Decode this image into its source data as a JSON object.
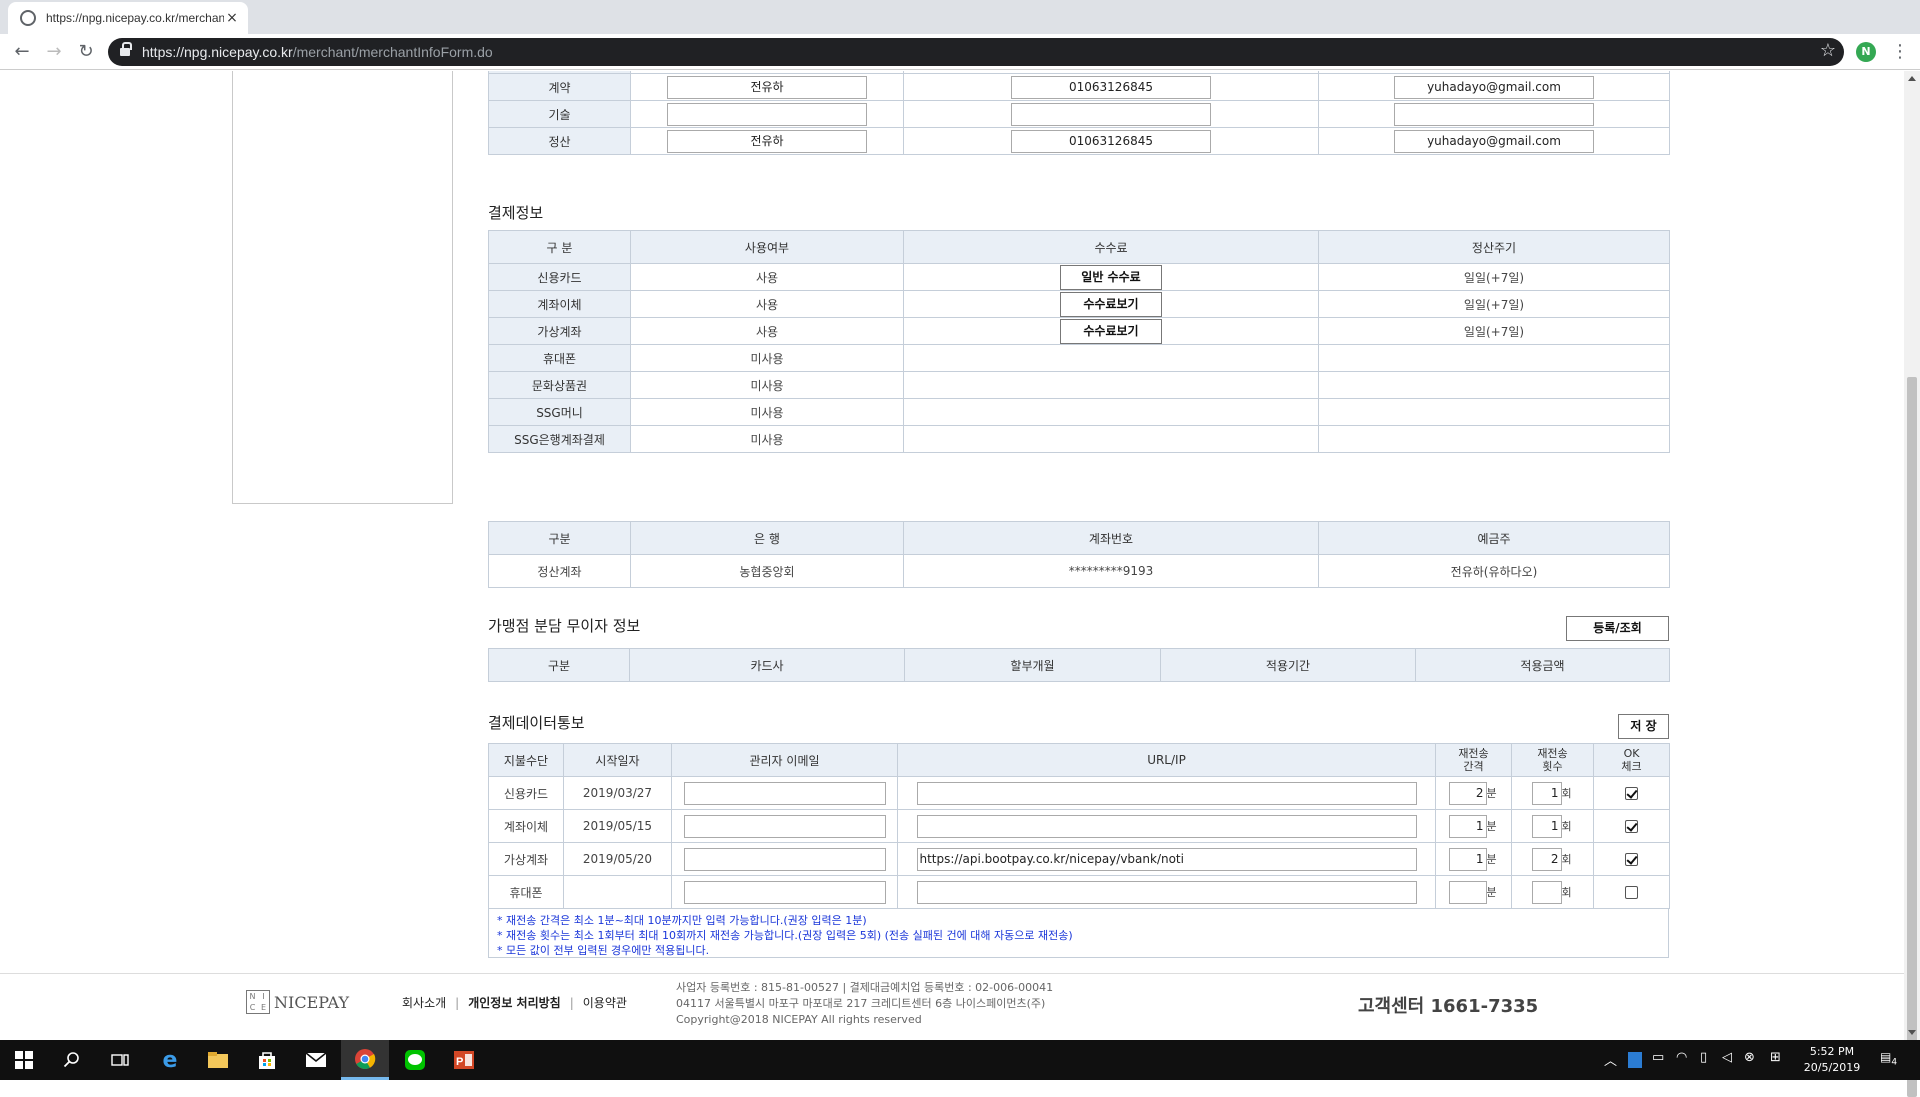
{
  "browser": {
    "tab_title": "https://npg.nicepay.co.kr/merchant",
    "tab_close": "×",
    "url_host": "https://npg.nicepay.co.kr",
    "url_path": "/merchant/merchantInfoForm.do",
    "profile_initial": "N"
  },
  "contacts": {
    "rows": [
      {
        "label": "계약",
        "name": "전유하",
        "phone": "01063126845",
        "email": "yuhadayo@gmail.com"
      },
      {
        "label": "기술",
        "name": "",
        "phone": "",
        "email": ""
      },
      {
        "label": "정산",
        "name": "전유하",
        "phone": "01063126845",
        "email": "yuhadayo@gmail.com"
      }
    ]
  },
  "payment_info": {
    "title": "결제정보",
    "headers": [
      "구 분",
      "사용여부",
      "수수료",
      "정산주기"
    ],
    "rows": [
      {
        "method": "신용카드",
        "usage": "사용",
        "fee_button": "일반 수수료",
        "cycle": "일일(+7일)"
      },
      {
        "method": "계좌이체",
        "usage": "사용",
        "fee_button": "수수료보기",
        "cycle": "일일(+7일)"
      },
      {
        "method": "가상계좌",
        "usage": "사용",
        "fee_button": "수수료보기",
        "cycle": "일일(+7일)"
      },
      {
        "method": "휴대폰",
        "usage": "미사용",
        "fee_button": "",
        "cycle": ""
      },
      {
        "method": "문화상품권",
        "usage": "미사용",
        "fee_button": "",
        "cycle": ""
      },
      {
        "method": "SSG머니",
        "usage": "미사용",
        "fee_button": "",
        "cycle": ""
      },
      {
        "method": "SSG은행계좌결제",
        "usage": "미사용",
        "fee_button": "",
        "cycle": ""
      }
    ]
  },
  "settlement_account": {
    "headers": [
      "구분",
      "은 행",
      "계좌번호",
      "예금주"
    ],
    "row": {
      "type": "정산계좌",
      "bank": "농협중앙회",
      "account": "*********9193",
      "holder": "전유하(유하다오)"
    }
  },
  "installment": {
    "title": "가맹점 분담 무이자 정보",
    "button": "등록/조회",
    "headers": [
      "구분",
      "카드사",
      "할부개월",
      "적용기간",
      "적용금액"
    ]
  },
  "notification": {
    "title": "결제데이터통보",
    "save_button": "저 장",
    "headers": [
      "지불수단",
      "시작일자",
      "관리자 이메일",
      "URL/IP",
      "재전송\n간격",
      "재전송\n횟수",
      "OK\n체크"
    ],
    "interval_unit": "분",
    "count_unit": "회",
    "rows": [
      {
        "method": "신용카드",
        "start": "2019/03/27",
        "email": "",
        "url": "",
        "interval": "2",
        "count": "1",
        "checked": true
      },
      {
        "method": "계좌이체",
        "start": "2019/05/15",
        "email": "",
        "url": "",
        "interval": "1",
        "count": "1",
        "checked": true
      },
      {
        "method": "가상계좌",
        "start": "2019/05/20",
        "email": "",
        "url": "https://api.bootpay.co.kr/nicepay/vbank/noti",
        "interval": "1",
        "count": "2",
        "checked": true
      },
      {
        "method": "휴대폰",
        "start": "",
        "email": "",
        "url": "",
        "interval": "",
        "count": "",
        "checked": false
      }
    ],
    "notes": [
      "* 재전송 간격은 최소 1분~최대 10분까지만 입력 가능합니다.(권장 입력은 1분)",
      "* 재전송 횟수는 최소 1회부터 최대 10회까지 재전송 가능합니다.(권장 입력은 5회) (전송 실패된 건에 대해 자동으로 재전송)",
      "* 모든 값이 전부 입력된 경우에만 적용됩니다."
    ]
  },
  "footer": {
    "logo_text": "NICEPAY",
    "logo_mark": [
      "N",
      "I",
      "C",
      "E"
    ],
    "links": [
      "회사소개",
      "개인정보 처리방침",
      "이용약관"
    ],
    "info_lines": [
      "사업자 등록번호 : 815-81-00527 | 결제대금예치업 등록번호 : 02-006-00041",
      "04117 서울특별시 마포구 마포대로 217 크레디트센터 6층 나이스페이먼츠(주)",
      "Copyright@2018 NICEPAY All rights reserved"
    ],
    "customer_center": "고객센터 1661-7335"
  },
  "taskbar": {
    "time": "5:52 PM",
    "date": "20/5/2019",
    "notifications": "4"
  }
}
